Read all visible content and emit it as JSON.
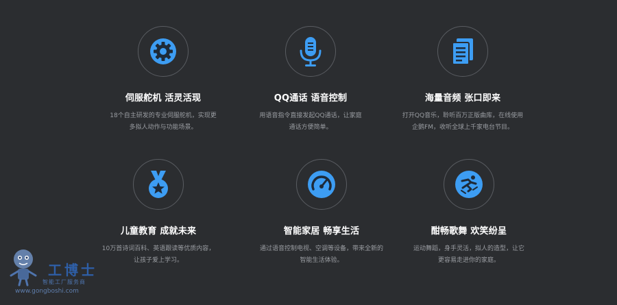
{
  "features": [
    {
      "icon": "gear-icon",
      "title": "伺服舵机 活灵活现",
      "desc_line1": "18个自主研发的专业伺服舵机，实现更",
      "desc_line2": "多拟人动作与功能场景。"
    },
    {
      "icon": "microphone-icon",
      "title": "QQ通话 语音控制",
      "desc_line1": "用语音指令直接发起QQ通话，让家庭",
      "desc_line2": "通话方便简单。"
    },
    {
      "icon": "document-icon",
      "title": "海量音频 张口即来",
      "desc_line1": "打开QQ音乐，聆听百万正版曲库，在线使用",
      "desc_line2": "企鹅FM，收听全球上千家电台节目。"
    },
    {
      "icon": "medal-icon",
      "title": "儿童教育 成就未来",
      "desc_line1": "10万首诗词百科、英语跟读等优质内容，",
      "desc_line2": "让孩子爱上学习。"
    },
    {
      "icon": "gauge-icon",
      "title": "智能家居 畅享生活",
      "desc_line1": "通过语音控制电视、空调等设备，带来全新的",
      "desc_line2": "智能生活体验。"
    },
    {
      "icon": "dancer-icon",
      "title": "酣畅歌舞 欢笑纷呈",
      "desc_line1": "运动舞蹈，身手灵活，拟人的造型，让它",
      "desc_line2": "更容易走进你的家庭。"
    }
  ],
  "watermark": {
    "brand": "工博士",
    "slogan": "智能工厂服务商",
    "url": "www.gongboshi.com"
  },
  "colors": {
    "background": "#2b2d30",
    "accent": "#3d9df3",
    "ring": "#5a5d62",
    "title": "#ffffff",
    "desc": "#9a9da2"
  }
}
